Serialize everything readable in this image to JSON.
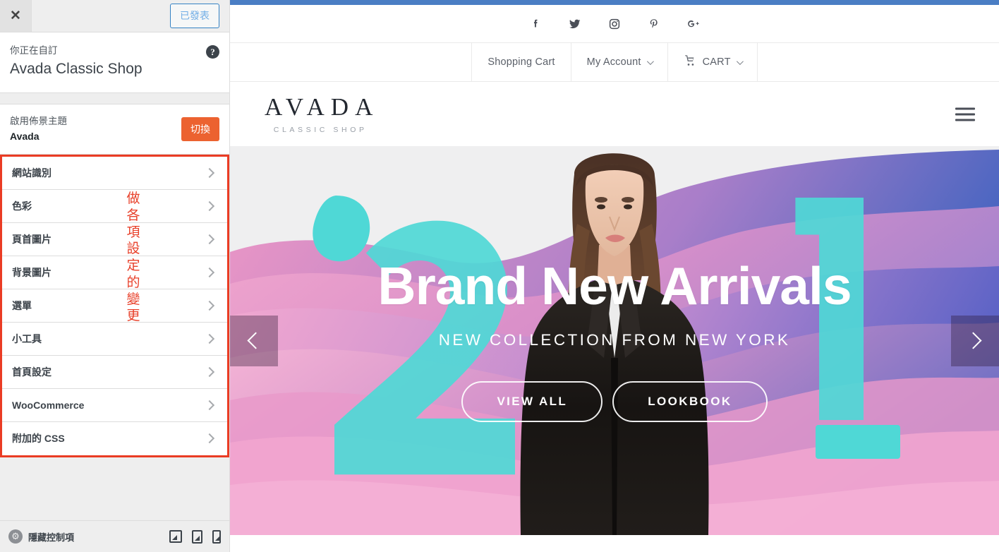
{
  "customizer": {
    "close_icon": "close-icon",
    "publish_label": "已發表",
    "header": {
      "eyebrow": "你正在自訂",
      "title": "Avada Classic Shop",
      "help_icon": "?"
    },
    "theme": {
      "label": "啟用佈景主題",
      "name": "Avada",
      "switch_label": "切換"
    },
    "sections": [
      {
        "label": "網站識別"
      },
      {
        "label": "色彩"
      },
      {
        "label": "頁首圖片"
      },
      {
        "label": "背景圖片"
      },
      {
        "label": "選單"
      },
      {
        "label": "小工具"
      },
      {
        "label": "首頁設定"
      },
      {
        "label": "WooCommerce"
      },
      {
        "label": "附加的 CSS"
      }
    ],
    "annotation": {
      "text": "做各項設定的變更",
      "color": "#e8402a"
    },
    "footer": {
      "hide_controls_label": "隱藏控制項",
      "devices": [
        "desktop",
        "tablet",
        "mobile"
      ]
    },
    "accent_publish": "#3582c4",
    "accent_switch": "#ec6230",
    "highlight_color": "#ea3c24"
  },
  "preview": {
    "adminbar_color": "#4a7ec4",
    "social": [
      {
        "name": "facebook-icon"
      },
      {
        "name": "twitter-icon"
      },
      {
        "name": "instagram-icon"
      },
      {
        "name": "pinterest-icon"
      },
      {
        "name": "googleplus-icon"
      }
    ],
    "nav": [
      {
        "label": "Shopping Cart",
        "caret": false,
        "cart": false
      },
      {
        "label": "My Account",
        "caret": true,
        "cart": false
      },
      {
        "label": "CART",
        "caret": true,
        "cart": true
      }
    ],
    "logo": {
      "main": "AVADA",
      "sub": "CLASSIC SHOP"
    },
    "hero": {
      "title": "Brand New Arrivals",
      "subtitle": "NEW COLLECTION FROM NEW YORK",
      "buttons": [
        {
          "label": "VIEW ALL"
        },
        {
          "label": "LOOKBOOK"
        }
      ],
      "numerals": {
        "left": "2",
        "right": "1"
      },
      "accent_cyan": "#4fd8d6"
    }
  }
}
